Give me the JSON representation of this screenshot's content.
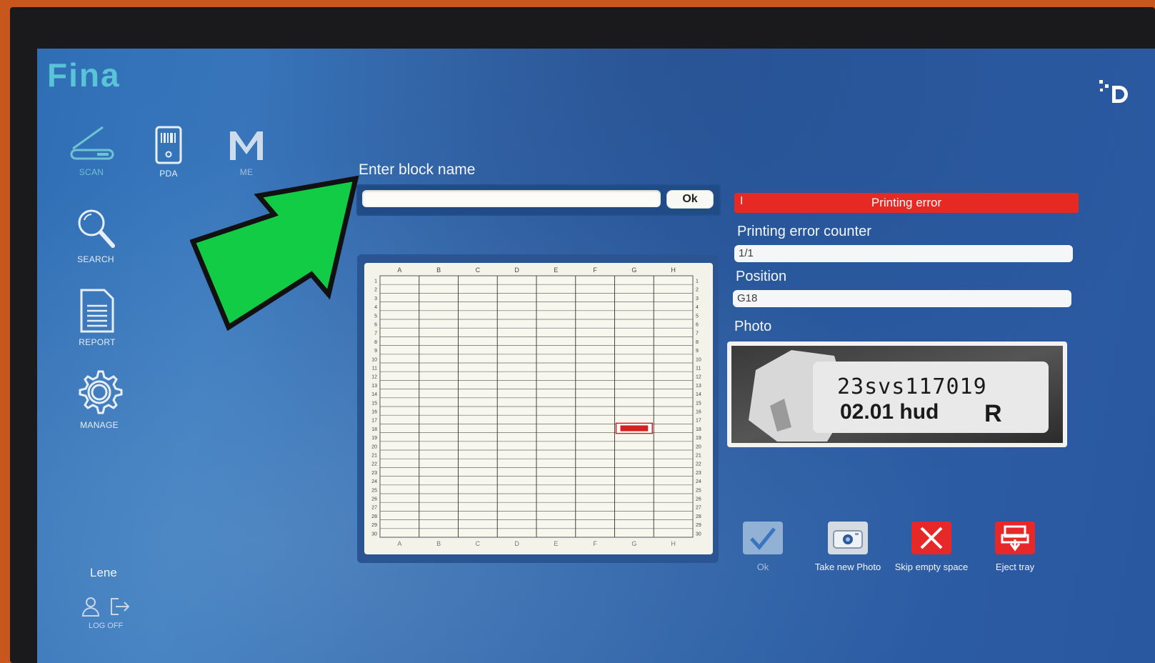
{
  "app": {
    "brand": "Fina"
  },
  "nav": {
    "scan": "SCAN",
    "pda": "PDA",
    "menu": "ME",
    "search": "SEARCH",
    "report": "REPORT",
    "manage": "MANAGE"
  },
  "user": {
    "name": "Lene",
    "logoff": "LOG OFF"
  },
  "block": {
    "heading": "Enter block name",
    "value": "",
    "ok_label": "Ok"
  },
  "grid": {
    "columns": [
      "A",
      "B",
      "C",
      "D",
      "E",
      "F",
      "G",
      "H"
    ],
    "rows": [
      "1",
      "2",
      "3",
      "4",
      "5",
      "6",
      "7",
      "8",
      "9",
      "10",
      "11",
      "12",
      "13",
      "14",
      "15",
      "16",
      "17",
      "18",
      "19",
      "20",
      "21",
      "22",
      "23",
      "24",
      "25",
      "26",
      "27",
      "28",
      "29",
      "30"
    ],
    "marked_cell": "G18"
  },
  "status": {
    "error_text": "Printing error",
    "cursor_glyph": "I"
  },
  "counter": {
    "label": "Printing error counter",
    "value": "1/1"
  },
  "position": {
    "label": "Position",
    "value": "G18"
  },
  "photo": {
    "label": "Photo",
    "line1": "23svs117019",
    "line2": "02.01 hud",
    "line2_right": "R"
  },
  "actions": {
    "ok": "Ok",
    "take_photo": "Take new Photo",
    "skip": "Skip empty space",
    "eject": "Eject tray"
  },
  "colors": {
    "accent": "#58c4d6",
    "error": "#e62923",
    "arrow": "#12cc45"
  },
  "icons": [
    "scanner-icon",
    "pda-icon",
    "menu-m-icon",
    "search-icon",
    "report-icon",
    "gear-icon",
    "user-icon",
    "logoff-icon",
    "checkmark-icon",
    "camera-icon",
    "close-icon",
    "printer-eject-icon"
  ]
}
